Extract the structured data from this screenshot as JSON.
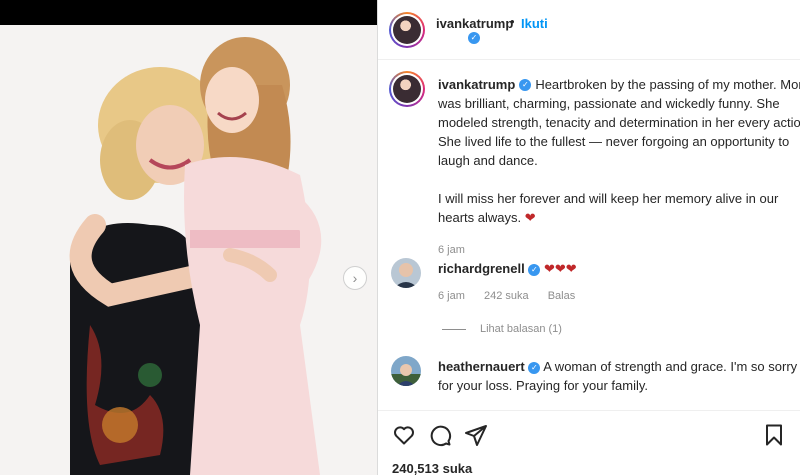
{
  "post": {
    "author": "ivankatrump",
    "follow_label": "Ikuti",
    "dot": "•"
  },
  "caption": {
    "username": "ivankatrump",
    "lines1": [
      "Heartbroken by the passing of my mother. Mom",
      "was brilliant, charming, passionate and wickedly funny. She",
      "modeled strength, tenacity and determination in her every action.",
      "She lived life to the fullest — never forgoing an opportunity to",
      "laugh and dance."
    ],
    "lines2": [
      "I will miss her forever and will keep her memory alive in our",
      "hearts always."
    ],
    "heart": "❤",
    "time": "6 jam"
  },
  "comments": [
    {
      "username": "richardgrenell",
      "text": "❤❤❤",
      "time": "6 jam",
      "likes": "242 suka",
      "reply_label": "Balas",
      "view_replies": "Lihat balasan (1)"
    },
    {
      "username": "heathernauert",
      "text_line1": "A woman of strength and grace. I'm so sorry",
      "text_line2": "for your loss. Praying for your family."
    }
  ],
  "actions": {
    "like_icon": "heart-outline-icon",
    "comment_icon": "comment-icon",
    "share_icon": "share-icon",
    "save_icon": "bookmark-icon",
    "likes_count": "240,513 suka"
  },
  "colors": {
    "link_blue": "#0095f6",
    "verified_blue": "#3897f0",
    "heart_red": "#c0282a"
  }
}
